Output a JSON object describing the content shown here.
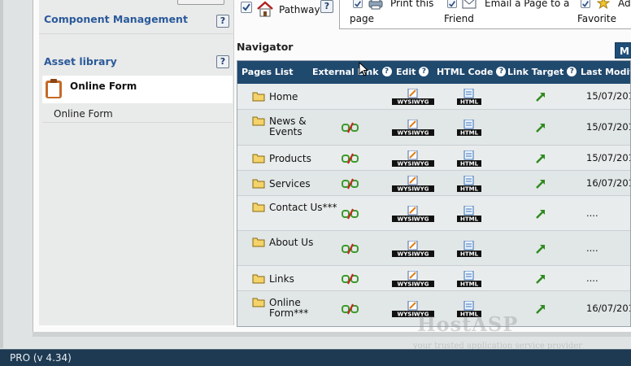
{
  "left_panel": {
    "component_management": "Component Management",
    "asset_library": "Asset library",
    "asset_item": "Online Form",
    "asset_sub": "Online Form",
    "help": "?"
  },
  "toolbar": {
    "pathway": "Pathway",
    "print_line1": "Print this",
    "print_line2": "page",
    "email_line1": "Email a Page to a",
    "email_line2": "Friend",
    "fav_line1": "Ad",
    "fav_line2": "Favorite"
  },
  "navigator": {
    "title": "Navigator",
    "button": "M",
    "columns": [
      "Pages List",
      "External Link",
      "Edit",
      "HTML Code",
      "Link Target",
      "Last Modifi"
    ],
    "rows": [
      {
        "name": "Home",
        "date": "15/07/201"
      },
      {
        "name": "News & Events",
        "date": "15/07/201"
      },
      {
        "name": "Products",
        "date": "15/07/201"
      },
      {
        "name": "Services",
        "date": "16/07/201"
      },
      {
        "name": "Contact Us***",
        "date": "...."
      },
      {
        "name": "About Us",
        "date": "...."
      },
      {
        "name": "Links",
        "date": "...."
      },
      {
        "name": "Online Form***",
        "date": "16/07/201"
      }
    ],
    "edit_label": "WYSIWYG",
    "html_label": "HTML"
  },
  "status": {
    "version": "PRO (v 4.34)"
  },
  "watermark": {
    "brand": "HostASP",
    "tagline": "your trusted application service provider"
  },
  "colors": {
    "header_bg": "#20496e",
    "accent_blue": "#2a5a9a",
    "statusbar": "#1e3a52"
  }
}
